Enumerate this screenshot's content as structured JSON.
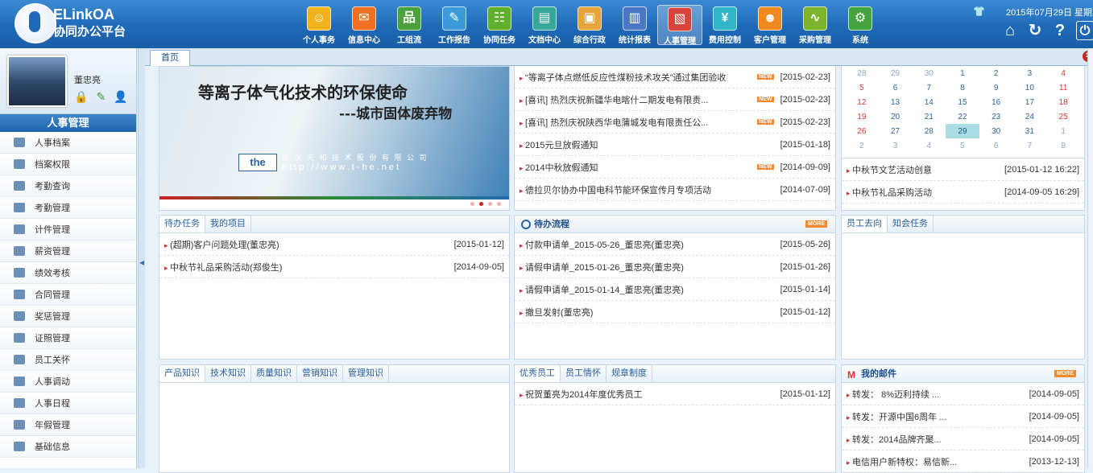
{
  "brand": {
    "name": "ELinkOA",
    "subtitle": "协同办公平台"
  },
  "nav": [
    {
      "label": "个人事务",
      "color": "#f2b21b",
      "glyph": "☺"
    },
    {
      "label": "信息中心",
      "color": "#f07021",
      "glyph": "✉"
    },
    {
      "label": "工组流",
      "color": "#49a23a",
      "glyph": "品"
    },
    {
      "label": "工作报告",
      "color": "#3b9ad9",
      "glyph": "✎"
    },
    {
      "label": "协同任务",
      "color": "#5fb02c",
      "glyph": "☷"
    },
    {
      "label": "文档中心",
      "color": "#37a79a",
      "glyph": "▤"
    },
    {
      "label": "综合行政",
      "color": "#e7a43a",
      "glyph": "▣"
    },
    {
      "label": "统计报表",
      "color": "#4a76c6",
      "glyph": "▥"
    },
    {
      "label": "人事管理",
      "color": "#d8443b",
      "glyph": "▧"
    },
    {
      "label": "费用控制",
      "color": "#2fb4c8",
      "glyph": "¥"
    },
    {
      "label": "客户管理",
      "color": "#f08a1f",
      "glyph": "☻"
    },
    {
      "label": "采购管理",
      "color": "#7cb42b",
      "glyph": "∿"
    },
    {
      "label": "系统",
      "color": "#45a33f",
      "glyph": "⚙"
    }
  ],
  "header": {
    "date": "2015年07月29日 星期三",
    "icons": [
      "home-icon",
      "refresh-icon",
      "help-icon",
      "power-icon"
    ]
  },
  "user": {
    "name": "董忠亮"
  },
  "sidebar": {
    "title": "人事管理",
    "items": [
      "人事档案",
      "档案权限",
      "考勤查询",
      "考勤管理",
      "计件管理",
      "薪资管理",
      "绩效考核",
      "合同管理",
      "奖惩管理",
      "证照管理",
      "员工关怀",
      "人事调动",
      "人事日程",
      "年假管理",
      "基础信息"
    ]
  },
  "tabs": {
    "home": "首页"
  },
  "banner": {
    "line1": "等离子体气化技术的环保使命",
    "line2": "---城市固体废弃物",
    "company": "武 汉 天 和 技 术 股 份 有 限 公 司",
    "url": "http://www.t-he.net",
    "logo": "the"
  },
  "news": [
    {
      "title": "“等离子体点燃低反应性煤粉技术攻关”通过集团验收",
      "date": "[2015-02-23]",
      "new": true
    },
    {
      "title": "[喜讯] 热烈庆祝新疆华电喀什二期发电有限责...",
      "date": "[2015-02-23]",
      "new": true
    },
    {
      "title": "[喜讯] 热烈庆祝陕西华电蒲城发电有限责任公...",
      "date": "[2015-02-23]",
      "new": true
    },
    {
      "title": "2015元旦放假通知",
      "date": "[2015-01-18]",
      "new": false
    },
    {
      "title": "2014中秋放假通知",
      "date": "[2014-09-09]",
      "new": true
    },
    {
      "title": "德拉贝尔协办中国电科节能环保宣传月专项活动",
      "date": "[2014-07-09]",
      "new": false
    }
  ],
  "calendar": {
    "weeks": [
      [
        "28",
        "29",
        "30",
        "1",
        "2",
        "3",
        "4"
      ],
      [
        "5",
        "6",
        "7",
        "8",
        "9",
        "10",
        "11"
      ],
      [
        "12",
        "13",
        "14",
        "15",
        "16",
        "17",
        "18"
      ],
      [
        "19",
        "20",
        "21",
        "22",
        "23",
        "24",
        "25"
      ],
      [
        "26",
        "27",
        "28",
        "29",
        "30",
        "31",
        "1"
      ],
      [
        "2",
        "3",
        "4",
        "5",
        "6",
        "7",
        "8"
      ]
    ],
    "today": "29"
  },
  "events": [
    {
      "title": "中秋节文艺活动创意",
      "date": "[2015-01-12 16:22]"
    },
    {
      "title": "中秋节礼品采购活动",
      "date": "[2014-09-05 16:29]"
    }
  ],
  "tasks": {
    "tabs": [
      "待办任务",
      "我的项目"
    ],
    "rows": [
      {
        "title": "(超期)客户问题处理(董忠亮)",
        "date": "[2015-01-12]"
      },
      {
        "title": "中秋节礼品采购活动(郑俊生)",
        "date": "[2014-09-05]"
      }
    ]
  },
  "workflow": {
    "title": "待办流程",
    "more": "MORE",
    "rows": [
      {
        "title": "付款申请单_2015-05-26_董忠亮(董忠亮)",
        "date": "[2015-05-26]"
      },
      {
        "title": "请假申请单_2015-01-26_董忠亮(董忠亮)",
        "date": "[2015-01-26]"
      },
      {
        "title": "请假申请单_2015-01-14_董忠亮(董忠亮)",
        "date": "[2015-01-14]"
      },
      {
        "title": "撤旦发射(董忠亮)",
        "date": "[2015-01-12]"
      }
    ]
  },
  "staff": {
    "tabs": [
      "员工去向",
      "知会任务"
    ]
  },
  "knowledge": {
    "tabs": [
      "产品知识",
      "技术知识",
      "质量知识",
      "营销知识",
      "管理知识"
    ]
  },
  "excellent": {
    "tabs": [
      "优秀员工",
      "员工情怀",
      "规章制度"
    ],
    "rows": [
      {
        "title": "祝贺董亮为2014年度优秀员工",
        "date": "[2015-01-12]"
      }
    ]
  },
  "mail": {
    "title": "我的邮件",
    "more": "MORE",
    "rows": [
      {
        "title": "转发： 8%迈利持续 ...",
        "date": "[2014-09-05]"
      },
      {
        "title": "转发：开源中国6周年 ...",
        "date": "[2014-09-05]"
      },
      {
        "title": "转发：2014品牌齐聚...",
        "date": "[2014-09-05]"
      },
      {
        "title": "电信用户新特权：易信新...",
        "date": "[2013-12-13]"
      }
    ]
  }
}
